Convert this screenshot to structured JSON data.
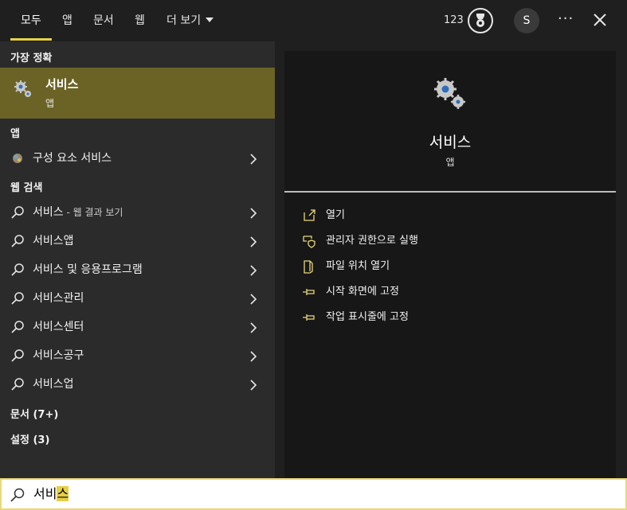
{
  "tabs": [
    {
      "label": "모두",
      "active": true
    },
    {
      "label": "앱"
    },
    {
      "label": "문서"
    },
    {
      "label": "웹"
    },
    {
      "label": "더 보기"
    }
  ],
  "header": {
    "points": "123",
    "avatar_initial": "S",
    "more_label": "···"
  },
  "best_match": {
    "heading": "가장 정확",
    "title": "서비스",
    "subtitle": "앱",
    "icon": "gears-icon"
  },
  "apps": {
    "heading": "앱",
    "items": [
      {
        "label": "구성 요소 서비스",
        "icon": "component-services-icon"
      }
    ]
  },
  "web": {
    "heading": "웹 검색",
    "items": [
      {
        "label": "서비스",
        "suffix": " - 웹 결과 보기"
      },
      {
        "label": "서비스앱"
      },
      {
        "label": "서비스 및 응용프로그램"
      },
      {
        "label": "서비스관리"
      },
      {
        "label": "서비스센터"
      },
      {
        "label": "서비스공구"
      },
      {
        "label": "서비스업"
      }
    ]
  },
  "more_sections": [
    {
      "label": "문서",
      "count": "(7+)"
    },
    {
      "label": "설정",
      "count": "(3)"
    }
  ],
  "preview": {
    "title": "서비스",
    "subtitle": "앱",
    "actions": [
      {
        "label": "열기",
        "icon": "open-icon"
      },
      {
        "label": "관리자 권한으로 실행",
        "icon": "shield-icon"
      },
      {
        "label": "파일 위치 열기",
        "icon": "file-location-icon"
      },
      {
        "label": "시작 화면에 고정",
        "icon": "pin-icon"
      },
      {
        "label": "작업 표시줄에 고정",
        "icon": "pin-icon"
      }
    ]
  },
  "search": {
    "value_plain": "서비",
    "value_highlight": "스"
  },
  "colors": {
    "accent": "#e6d04a",
    "selected_bg": "#6b6326",
    "panel_bg": "#2b2b2b",
    "preview_bg": "#171717"
  }
}
